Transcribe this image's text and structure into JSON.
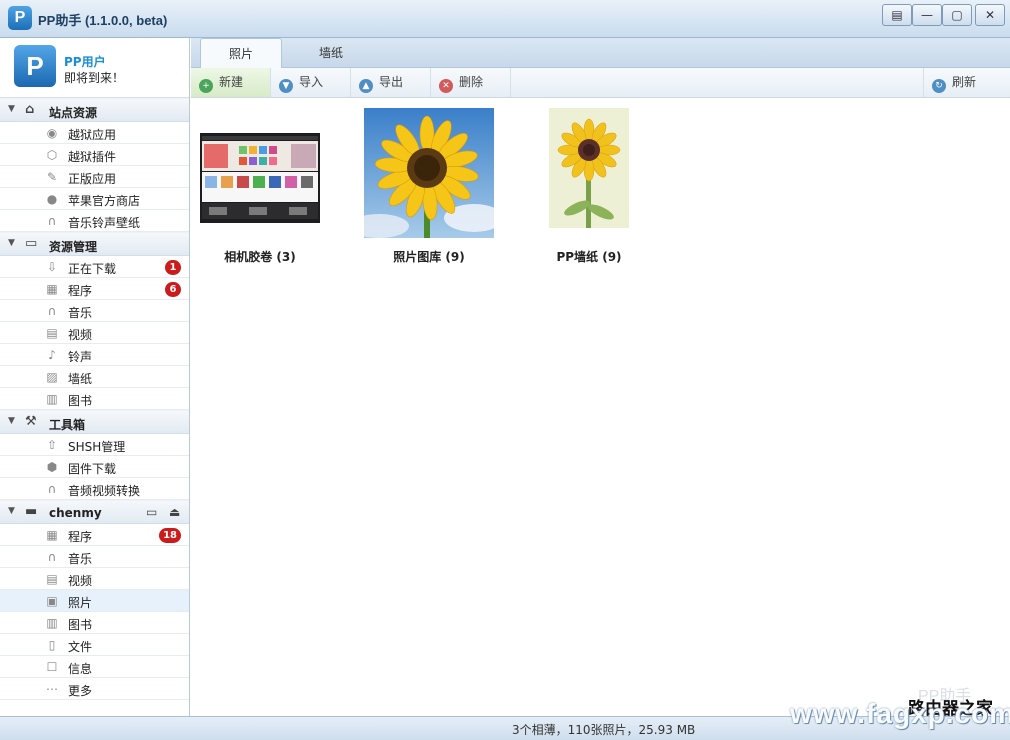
{
  "window": {
    "title": "PP助手 (1.1.0.0, beta)",
    "logo_letter": "P",
    "buttons": {
      "skin": "▤",
      "minimize": "—",
      "maximize": "▢",
      "close": "✕"
    }
  },
  "user": {
    "avatar_letter": "P",
    "name": "PP用户",
    "subtitle": "即将到来！"
  },
  "sidebar": {
    "sections": [
      {
        "label": "站点资源",
        "icon": "home-icon",
        "items": [
          {
            "label": "越狱应用",
            "icon": "app-icon"
          },
          {
            "label": "越狱插件",
            "icon": "plugin-icon"
          },
          {
            "label": "正版应用",
            "icon": "appstore-icon"
          },
          {
            "label": "苹果官方商店",
            "icon": "apple-icon"
          },
          {
            "label": "音乐铃声壁纸",
            "icon": "headphone-icon"
          }
        ]
      },
      {
        "label": "资源管理",
        "icon": "monitor-icon",
        "items": [
          {
            "label": "正在下载",
            "icon": "download-icon",
            "badge": "1"
          },
          {
            "label": "程序",
            "icon": "program-icon",
            "badge": "6"
          },
          {
            "label": "音乐",
            "icon": "headphone-icon"
          },
          {
            "label": "视频",
            "icon": "film-icon"
          },
          {
            "label": "铃声",
            "icon": "note-icon"
          },
          {
            "label": "墙纸",
            "icon": "picture-icon"
          },
          {
            "label": "图书",
            "icon": "book-icon"
          }
        ]
      },
      {
        "label": "工具箱",
        "icon": "toolbox-icon",
        "items": [
          {
            "label": "SHSH管理",
            "icon": "shsh-icon"
          },
          {
            "label": "固件下载",
            "icon": "firmware-icon"
          },
          {
            "label": "音频视频转换",
            "icon": "convert-icon"
          }
        ]
      },
      {
        "label": "chenmy",
        "icon": "device-icon",
        "items": [
          {
            "label": "程序",
            "icon": "program-icon",
            "badge": "18"
          },
          {
            "label": "音乐",
            "icon": "headphone-icon"
          },
          {
            "label": "视频",
            "icon": "film-icon"
          },
          {
            "label": "照片",
            "icon": "photo-icon",
            "active": true
          },
          {
            "label": "图书",
            "icon": "book-icon"
          },
          {
            "label": "文件",
            "icon": "file-icon"
          },
          {
            "label": "信息",
            "icon": "message-icon"
          },
          {
            "label": "更多",
            "icon": "more-icon"
          }
        ]
      }
    ]
  },
  "tabs": [
    {
      "label": "照片",
      "active": true
    },
    {
      "label": "墙纸",
      "active": false
    }
  ],
  "toolbar": {
    "new_label": "新建",
    "import_label": "导入",
    "export_label": "导出",
    "delete_label": "删除",
    "refresh_label": "刷新"
  },
  "albums": [
    {
      "label": "相机胶卷 (3)",
      "kind": "screenshot"
    },
    {
      "label": "照片图库 (9)",
      "kind": "sunflower-sky"
    },
    {
      "label": "PP墙纸 (9)",
      "kind": "sunflower-pale"
    }
  ],
  "status": {
    "text": "3个相薄，110张照片，25.93 MB"
  },
  "watermark": {
    "text": "www.fagxp.com",
    "top_text": "路由器之家",
    "pp": "PP助手"
  },
  "colors": {
    "accent": "#1b8fd6",
    "badge": "#cc1b1b",
    "titlebar": "#c9dcee"
  }
}
